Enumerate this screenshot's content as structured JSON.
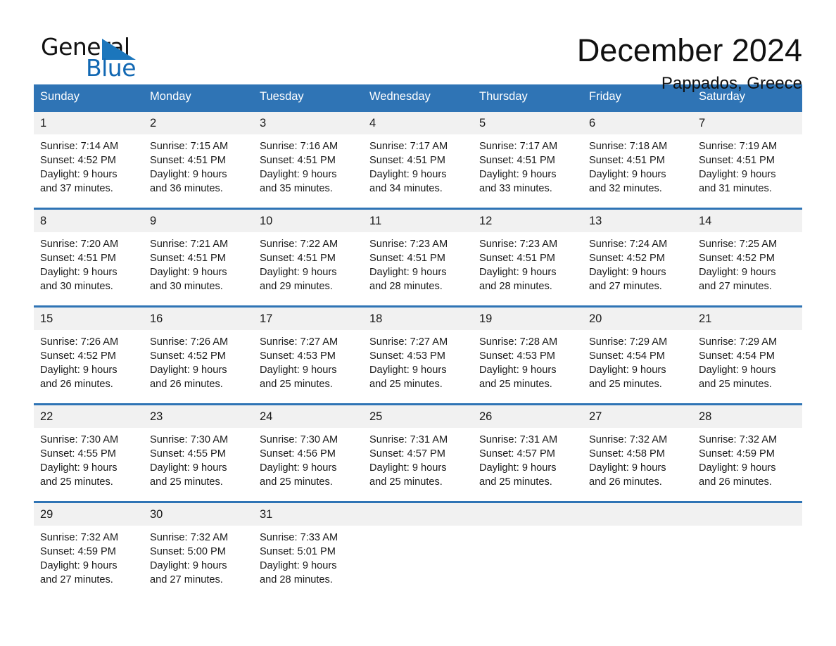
{
  "brand": {
    "word1": "General",
    "word2": "Blue",
    "triangle_color": "#1b76bc",
    "blue_text_color": "#1268b3"
  },
  "header": {
    "month_title": "December 2024",
    "location": "Pappados, Greece"
  },
  "colors": {
    "header_blue": "#2f74b5",
    "daynum_band": "#f1f1f1",
    "text": "#1a1a1a"
  },
  "weekday_headers": [
    "Sunday",
    "Monday",
    "Tuesday",
    "Wednesday",
    "Thursday",
    "Friday",
    "Saturday"
  ],
  "labels": {
    "sunrise_prefix": "Sunrise:",
    "sunset_prefix": "Sunset:",
    "daylight_prefix": "Daylight:"
  },
  "weeks": [
    [
      {
        "day": "1",
        "sunrise": "Sunrise: 7:14 AM",
        "sunset": "Sunset: 4:52 PM",
        "daylight_line1": "Daylight: 9 hours",
        "daylight_line2": "and 37 minutes."
      },
      {
        "day": "2",
        "sunrise": "Sunrise: 7:15 AM",
        "sunset": "Sunset: 4:51 PM",
        "daylight_line1": "Daylight: 9 hours",
        "daylight_line2": "and 36 minutes."
      },
      {
        "day": "3",
        "sunrise": "Sunrise: 7:16 AM",
        "sunset": "Sunset: 4:51 PM",
        "daylight_line1": "Daylight: 9 hours",
        "daylight_line2": "and 35 minutes."
      },
      {
        "day": "4",
        "sunrise": "Sunrise: 7:17 AM",
        "sunset": "Sunset: 4:51 PM",
        "daylight_line1": "Daylight: 9 hours",
        "daylight_line2": "and 34 minutes."
      },
      {
        "day": "5",
        "sunrise": "Sunrise: 7:17 AM",
        "sunset": "Sunset: 4:51 PM",
        "daylight_line1": "Daylight: 9 hours",
        "daylight_line2": "and 33 minutes."
      },
      {
        "day": "6",
        "sunrise": "Sunrise: 7:18 AM",
        "sunset": "Sunset: 4:51 PM",
        "daylight_line1": "Daylight: 9 hours",
        "daylight_line2": "and 32 minutes."
      },
      {
        "day": "7",
        "sunrise": "Sunrise: 7:19 AM",
        "sunset": "Sunset: 4:51 PM",
        "daylight_line1": "Daylight: 9 hours",
        "daylight_line2": "and 31 minutes."
      }
    ],
    [
      {
        "day": "8",
        "sunrise": "Sunrise: 7:20 AM",
        "sunset": "Sunset: 4:51 PM",
        "daylight_line1": "Daylight: 9 hours",
        "daylight_line2": "and 30 minutes."
      },
      {
        "day": "9",
        "sunrise": "Sunrise: 7:21 AM",
        "sunset": "Sunset: 4:51 PM",
        "daylight_line1": "Daylight: 9 hours",
        "daylight_line2": "and 30 minutes."
      },
      {
        "day": "10",
        "sunrise": "Sunrise: 7:22 AM",
        "sunset": "Sunset: 4:51 PM",
        "daylight_line1": "Daylight: 9 hours",
        "daylight_line2": "and 29 minutes."
      },
      {
        "day": "11",
        "sunrise": "Sunrise: 7:23 AM",
        "sunset": "Sunset: 4:51 PM",
        "daylight_line1": "Daylight: 9 hours",
        "daylight_line2": "and 28 minutes."
      },
      {
        "day": "12",
        "sunrise": "Sunrise: 7:23 AM",
        "sunset": "Sunset: 4:51 PM",
        "daylight_line1": "Daylight: 9 hours",
        "daylight_line2": "and 28 minutes."
      },
      {
        "day": "13",
        "sunrise": "Sunrise: 7:24 AM",
        "sunset": "Sunset: 4:52 PM",
        "daylight_line1": "Daylight: 9 hours",
        "daylight_line2": "and 27 minutes."
      },
      {
        "day": "14",
        "sunrise": "Sunrise: 7:25 AM",
        "sunset": "Sunset: 4:52 PM",
        "daylight_line1": "Daylight: 9 hours",
        "daylight_line2": "and 27 minutes."
      }
    ],
    [
      {
        "day": "15",
        "sunrise": "Sunrise: 7:26 AM",
        "sunset": "Sunset: 4:52 PM",
        "daylight_line1": "Daylight: 9 hours",
        "daylight_line2": "and 26 minutes."
      },
      {
        "day": "16",
        "sunrise": "Sunrise: 7:26 AM",
        "sunset": "Sunset: 4:52 PM",
        "daylight_line1": "Daylight: 9 hours",
        "daylight_line2": "and 26 minutes."
      },
      {
        "day": "17",
        "sunrise": "Sunrise: 7:27 AM",
        "sunset": "Sunset: 4:53 PM",
        "daylight_line1": "Daylight: 9 hours",
        "daylight_line2": "and 25 minutes."
      },
      {
        "day": "18",
        "sunrise": "Sunrise: 7:27 AM",
        "sunset": "Sunset: 4:53 PM",
        "daylight_line1": "Daylight: 9 hours",
        "daylight_line2": "and 25 minutes."
      },
      {
        "day": "19",
        "sunrise": "Sunrise: 7:28 AM",
        "sunset": "Sunset: 4:53 PM",
        "daylight_line1": "Daylight: 9 hours",
        "daylight_line2": "and 25 minutes."
      },
      {
        "day": "20",
        "sunrise": "Sunrise: 7:29 AM",
        "sunset": "Sunset: 4:54 PM",
        "daylight_line1": "Daylight: 9 hours",
        "daylight_line2": "and 25 minutes."
      },
      {
        "day": "21",
        "sunrise": "Sunrise: 7:29 AM",
        "sunset": "Sunset: 4:54 PM",
        "daylight_line1": "Daylight: 9 hours",
        "daylight_line2": "and 25 minutes."
      }
    ],
    [
      {
        "day": "22",
        "sunrise": "Sunrise: 7:30 AM",
        "sunset": "Sunset: 4:55 PM",
        "daylight_line1": "Daylight: 9 hours",
        "daylight_line2": "and 25 minutes."
      },
      {
        "day": "23",
        "sunrise": "Sunrise: 7:30 AM",
        "sunset": "Sunset: 4:55 PM",
        "daylight_line1": "Daylight: 9 hours",
        "daylight_line2": "and 25 minutes."
      },
      {
        "day": "24",
        "sunrise": "Sunrise: 7:30 AM",
        "sunset": "Sunset: 4:56 PM",
        "daylight_line1": "Daylight: 9 hours",
        "daylight_line2": "and 25 minutes."
      },
      {
        "day": "25",
        "sunrise": "Sunrise: 7:31 AM",
        "sunset": "Sunset: 4:57 PM",
        "daylight_line1": "Daylight: 9 hours",
        "daylight_line2": "and 25 minutes."
      },
      {
        "day": "26",
        "sunrise": "Sunrise: 7:31 AM",
        "sunset": "Sunset: 4:57 PM",
        "daylight_line1": "Daylight: 9 hours",
        "daylight_line2": "and 25 minutes."
      },
      {
        "day": "27",
        "sunrise": "Sunrise: 7:32 AM",
        "sunset": "Sunset: 4:58 PM",
        "daylight_line1": "Daylight: 9 hours",
        "daylight_line2": "and 26 minutes."
      },
      {
        "day": "28",
        "sunrise": "Sunrise: 7:32 AM",
        "sunset": "Sunset: 4:59 PM",
        "daylight_line1": "Daylight: 9 hours",
        "daylight_line2": "and 26 minutes."
      }
    ],
    [
      {
        "day": "29",
        "sunrise": "Sunrise: 7:32 AM",
        "sunset": "Sunset: 4:59 PM",
        "daylight_line1": "Daylight: 9 hours",
        "daylight_line2": "and 27 minutes."
      },
      {
        "day": "30",
        "sunrise": "Sunrise: 7:32 AM",
        "sunset": "Sunset: 5:00 PM",
        "daylight_line1": "Daylight: 9 hours",
        "daylight_line2": "and 27 minutes."
      },
      {
        "day": "31",
        "sunrise": "Sunrise: 7:33 AM",
        "sunset": "Sunset: 5:01 PM",
        "daylight_line1": "Daylight: 9 hours",
        "daylight_line2": "and 28 minutes."
      },
      {
        "day": "",
        "sunrise": "",
        "sunset": "",
        "daylight_line1": "",
        "daylight_line2": ""
      },
      {
        "day": "",
        "sunrise": "",
        "sunset": "",
        "daylight_line1": "",
        "daylight_line2": ""
      },
      {
        "day": "",
        "sunrise": "",
        "sunset": "",
        "daylight_line1": "",
        "daylight_line2": ""
      },
      {
        "day": "",
        "sunrise": "",
        "sunset": "",
        "daylight_line1": "",
        "daylight_line2": ""
      }
    ]
  ]
}
